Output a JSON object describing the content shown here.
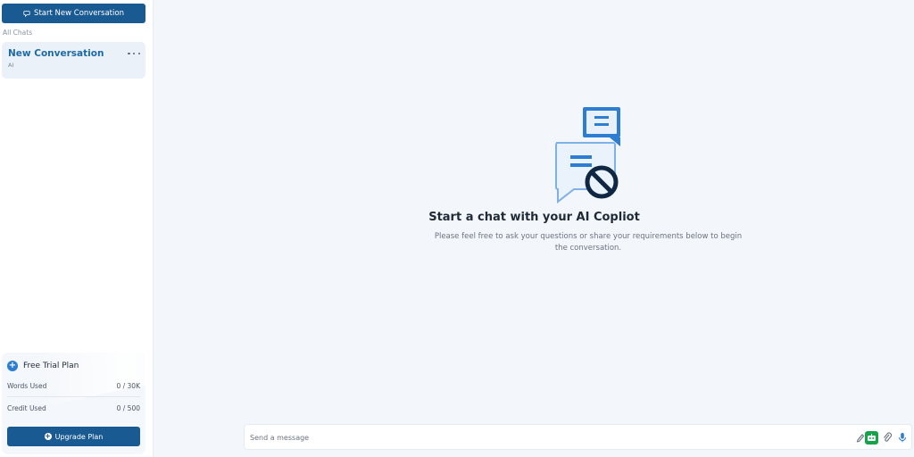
{
  "sidebar": {
    "start_button_label": "Start New Conversation",
    "section_label": "All Chats",
    "conversations": [
      {
        "title": "New Conversation",
        "subtitle": "AI"
      }
    ],
    "plan": {
      "title": "Free Trial Plan",
      "rows": [
        {
          "label": "Words Used",
          "value": "0 / 30K"
        },
        {
          "label": "Credit Used",
          "value": "0 / 500"
        }
      ],
      "upgrade_label": "Upgrade Plan"
    }
  },
  "main": {
    "empty_title": "Start a chat with your AI Copliot",
    "empty_subtitle": "Please feel free to ask your questions or share your requirements below to begin the conversation.",
    "composer": {
      "placeholder": "Send a message",
      "tools": [
        "pen-icon",
        "bot-icon",
        "paperclip-icon",
        "microphone-icon"
      ]
    }
  },
  "colors": {
    "accent": "#1a5a92",
    "link": "#1e6aa6",
    "bot": "#17a34a",
    "illustration_blue": "#2d7dd2",
    "illustration_dark": "#0f2742"
  }
}
